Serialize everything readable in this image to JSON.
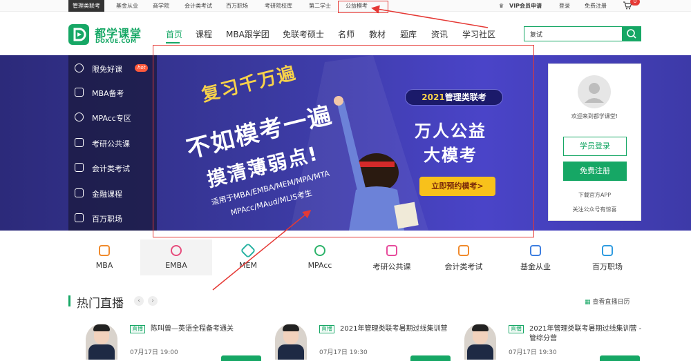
{
  "topbar": {
    "links": [
      "管理类联考",
      "基金从业",
      "商学院",
      "会计类考试",
      "百万职场",
      "考研院校库",
      "第二学士",
      "公益模考"
    ],
    "vip": "VIP会员申请",
    "login": "登录",
    "register": "免费注册",
    "cart_count": "0"
  },
  "header": {
    "logo_cn": "都学课堂",
    "logo_en": "DOXUE.COM",
    "nav": [
      "首页",
      "课程",
      "MBA跟学团",
      "免联考硕士",
      "名师",
      "教材",
      "题库",
      "资讯",
      "学习社区"
    ],
    "search_value": "复试"
  },
  "side_menu": {
    "items": [
      "限免好课",
      "MBA备考",
      "MPAcc专区",
      "考研公共课",
      "会计类考试",
      "金融课程",
      "百万职场"
    ],
    "hot": "hot"
  },
  "banner": {
    "line1": "复习千万遍",
    "line2": "不如模考一遍",
    "line3": "摸清薄弱点!",
    "line4": "适用于MBA/EMBA/MEM/MPA/MTA",
    "line5": "MPAcc/MAud/MLIS考生",
    "tag_year": "2021",
    "tag_text": "管理类联考",
    "big1": "万人公益",
    "big2": "大模考",
    "cta": "立即预约模考>"
  },
  "login_card": {
    "welcome": "欢迎来到都学课堂!",
    "student_login": "学员登录",
    "free_register": "免费注册",
    "download": "下载官方APP",
    "follow": "关注公众号有惊喜"
  },
  "categories": [
    "MBA",
    "EMBA",
    "MEM",
    "MPAcc",
    "考研公共课",
    "会计类考试",
    "基金从业",
    "百万职场"
  ],
  "live": {
    "title": "热门直播",
    "calendar": "查看直播日历",
    "badge": "直播",
    "cards": [
      {
        "title": "陈叫兽—英语全程备考通关",
        "time": "07月17日 19:00"
      },
      {
        "title": "2021年管理类联考暑期过线集训营",
        "time": "07月17日 19:30"
      },
      {
        "title": "2021年管理类联考暑期过线集训营 - 管综分营",
        "time": "07月17日 19:30"
      }
    ]
  },
  "colors": {
    "brand": "#16a765",
    "annotation": "#e53935",
    "banner": "#3b3aa1",
    "cta": "#f8c11b"
  }
}
